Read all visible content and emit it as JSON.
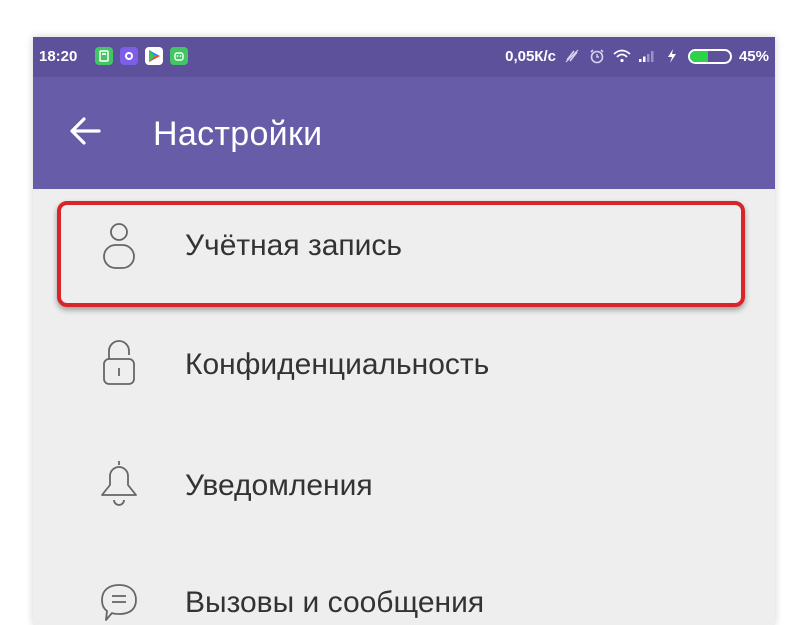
{
  "status_bar": {
    "time": "18:20",
    "network_speed": "0,05К/с",
    "battery_percent": "45%",
    "battery_level": 0.45,
    "app_icons": [
      "calculator-icon",
      "vpn-icon",
      "play-store-icon",
      "android-icon"
    ],
    "app_icon_colors": [
      "#43c565",
      "#7d5ee8",
      "#2b8ef0",
      "#43c565"
    ],
    "system_icons": [
      "nfc-icon",
      "alarm-icon",
      "wifi-icon",
      "signal-icon",
      "charging-icon"
    ]
  },
  "app_bar": {
    "title": "Настройки",
    "back_icon": "back-arrow-icon"
  },
  "settings": {
    "items": [
      {
        "label": "Учётная запись",
        "icon": "account-icon",
        "highlighted": true
      },
      {
        "label": "Конфиденциальность",
        "icon": "lock-icon",
        "highlighted": false
      },
      {
        "label": "Уведомления",
        "icon": "bell-icon",
        "highlighted": false
      },
      {
        "label": "Вызовы и сообщения",
        "icon": "chat-icon",
        "highlighted": false
      }
    ]
  },
  "colors": {
    "status_bar": "#5d519c",
    "app_bar": "#665ca8",
    "background": "#eeeeee",
    "highlight": "#d8252a",
    "label_text": "#333333",
    "battery_fill": "#2ed14a"
  }
}
